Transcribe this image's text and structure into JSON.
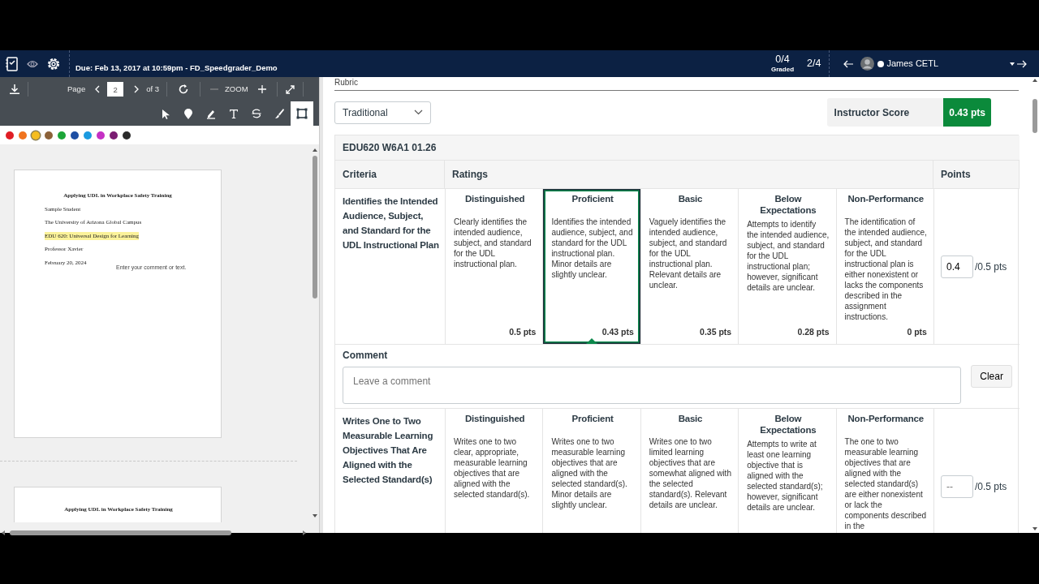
{
  "header": {
    "due": "Due: Feb 13, 2017 at 10:59pm - FD_Speedgrader_Demo",
    "graded_count": "0/4",
    "graded_label": "Graded",
    "position": "2/4",
    "student": "James CETL"
  },
  "viewer": {
    "page_label": "Page",
    "page": "2",
    "page_total": "of 3",
    "zoom_label": "ZOOM",
    "tools": [
      {
        "kind": "pointer",
        "selected": false
      },
      {
        "kind": "pin",
        "selected": false
      },
      {
        "kind": "highlighter",
        "selected": false
      },
      {
        "kind": "text",
        "selected": false
      },
      {
        "kind": "strikeout",
        "selected": false
      },
      {
        "kind": "brush",
        "selected": false
      },
      {
        "kind": "area",
        "selected": true
      }
    ],
    "colors": [
      {
        "color": "#e01e25",
        "selected": false
      },
      {
        "color": "#f0731e",
        "selected": false
      },
      {
        "color": "#f5bd1f",
        "selected": true
      },
      {
        "color": "#8c6239",
        "selected": false
      },
      {
        "color": "#1ca538",
        "selected": false
      },
      {
        "color": "#1e4fa3",
        "selected": false
      },
      {
        "color": "#1b9ae0",
        "selected": false
      },
      {
        "color": "#c530c4",
        "selected": false
      },
      {
        "color": "#7b1d72",
        "selected": false
      },
      {
        "color": "#2b2b2b",
        "selected": false
      }
    ],
    "pages": [
      {
        "title": "Applying UDL in Workplace Safety Training",
        "lines": [
          {
            "text": "Sample Student",
            "highlighted": false
          },
          {
            "text": "The University of Arizona Global Campus",
            "highlighted": false
          },
          {
            "text": "EDU 620: Universal Design for Learning",
            "highlighted": true
          },
          {
            "text": "Professor Xavier",
            "highlighted": false
          },
          {
            "text": "February 20, 2024",
            "highlighted": false
          }
        ],
        "comment": "Enter your comment or text."
      },
      {
        "title": "Applying UDL in Workplace Safety Training"
      }
    ]
  },
  "rubric": {
    "heading": "Rubric",
    "view": "Traditional",
    "score_label": "Instructor Score",
    "score": "0.43 pts",
    "title": "EDU620 W6A1 01.26",
    "columns": [
      "Criteria",
      "Ratings",
      "Points"
    ],
    "criteria": [
      {
        "title": "Identifies the Intended Audience, Subject, and Standard for the UDL Instructional Plan",
        "score": "0.4",
        "out_of": "/0.5 pts",
        "ratings": [
          {
            "title": "Distinguished",
            "description": "Clearly identifies the intended audience, subject, and standard for the UDL instructional plan.",
            "points": "0.5 pts",
            "selected": false
          },
          {
            "title": "Proficient",
            "description": "Identifies the intended audience, subject, and standard for the UDL instructional plan. Minor details are slightly unclear.",
            "points": "0.43 pts",
            "selected": true
          },
          {
            "title": "Basic",
            "description": "Vaguely identifies the intended audience, subject, and standard for the UDL instructional plan. Relevant details are unclear.",
            "points": "0.35 pts",
            "selected": false
          },
          {
            "title": "Below Expectations",
            "description": "Attempts to identify the intended audience, subject, and standard for the UDL instructional plan; however, significant details are unclear.",
            "points": "0.28 pts",
            "selected": false
          },
          {
            "title": "Non-Performance",
            "description": "The identification of the intended audience, subject, and standard for the UDL instructional plan is either nonexistent or lacks the components described in the assignment instructions.",
            "points": "0 pts",
            "selected": false
          }
        ],
        "comment": {
          "label": "Comment",
          "placeholder": "Leave a comment",
          "clear": "Clear"
        }
      },
      {
        "title": "Writes One to Two Measurable Learning Objectives That Are Aligned with the Selected Standard(s)",
        "score_placeholder": "--",
        "out_of": "/0.5 pts",
        "ratings": [
          {
            "title": "Distinguished",
            "description": "Writes one to two clear, appropriate, measurable learning objectives that are aligned with the selected standard(s).",
            "selected": false
          },
          {
            "title": "Proficient",
            "description": "Writes one to two measurable learning objectives that are aligned with the selected standard(s). Minor details are slightly unclear.",
            "selected": false
          },
          {
            "title": "Basic",
            "description": "Writes one to two limited learning objectives that are somewhat aligned with the selected standard(s). Relevant details are unclear.",
            "selected": false
          },
          {
            "title": "Below Expectations",
            "description": "Attempts to write at least one learning objective that is aligned with the selected standard(s); however, significant details are unclear.",
            "selected": false
          },
          {
            "title": "Non-Performance",
            "description": "The one to two measurable learning objectives that are aligned with the selected standard(s) are either nonexistent or lack the components described in the",
            "selected": false
          }
        ]
      }
    ]
  }
}
